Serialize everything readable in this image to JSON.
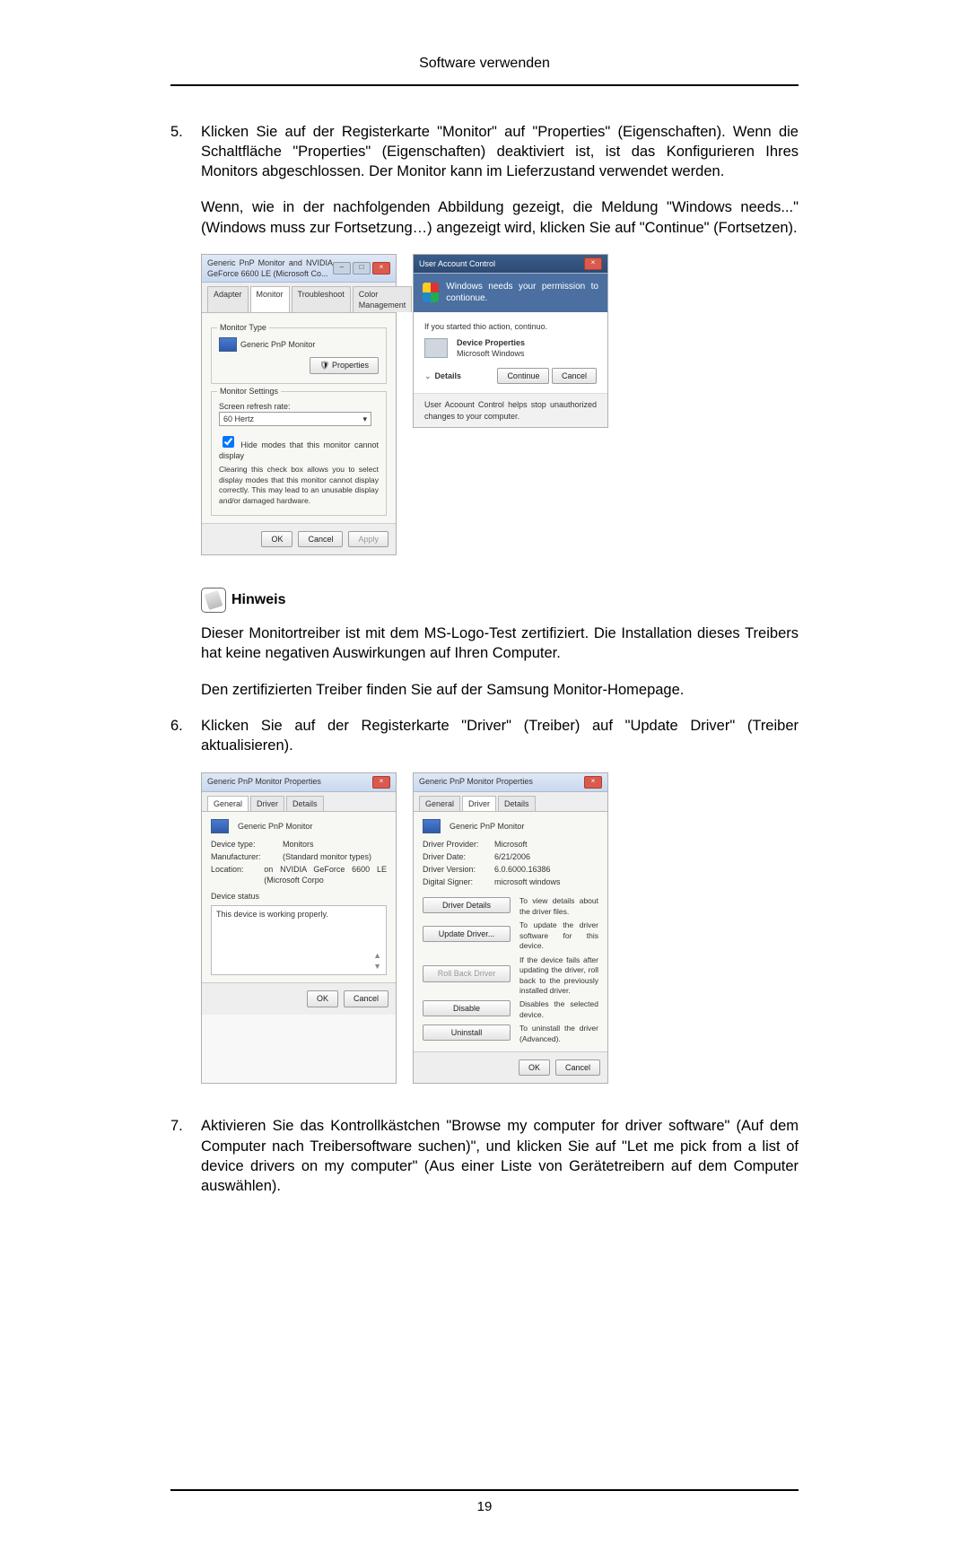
{
  "header": "Software verwenden",
  "item5": {
    "num": "5.",
    "p1": "Klicken Sie auf der Registerkarte \"Monitor\" auf \"Properties\" (Eigenschaften). Wenn die Schaltfläche \"Properties\" (Eigenschaften) deaktiviert ist, ist das Konfigurieren Ihres Monitors abgeschlossen. Der Monitor kann im Lieferzustand verwendet werden.",
    "p2": "Wenn, wie in der nachfolgenden Abbildung gezeigt, die Meldung \"Windows needs...\" (Windows muss zur Fortsetzung…) angezeigt wird, klicken Sie auf \"Continue\" (Fortsetzen)."
  },
  "screen1": {
    "title": "Generic PnP Monitor and NVIDIA GeForce 6600 LE (Microsoft Co...",
    "tabs": [
      "Adapter",
      "Monitor",
      "Troubleshoot",
      "Color Management"
    ],
    "active_tab": 1,
    "monitor_type_label": "Monitor Type",
    "monitor_type_value": "Generic PnP Monitor",
    "properties_btn": "Properties",
    "settings_label": "Monitor Settings",
    "refresh_label": "Screen refresh rate:",
    "refresh_value": "60 Hertz",
    "hide_modes": "Hide modes that this monitor cannot display",
    "hide_modes_desc": "Clearing this check box allows you to select display modes that this monitor cannot display correctly. This may lead to an unusable display and/or damaged hardware.",
    "ok": "OK",
    "cancel": "Cancel",
    "apply": "Apply"
  },
  "uac": {
    "title": "User Account Control",
    "headline": "Windows needs your permission to contionue.",
    "started": "If you started thio action, continuo.",
    "name": "Device Properties",
    "pub": "Microsoft Windows",
    "details": "Details",
    "continue": "Continue",
    "cancel": "Cancel",
    "footer": "User Acoount Control helps stop unauthorized changes to your computer."
  },
  "hinweis": {
    "label": "Hinweis",
    "p1": "Dieser Monitortreiber ist mit dem MS-Logo-Test zertifiziert. Die Installation dieses Treibers hat keine negativen Auswirkungen auf Ihren Computer.",
    "p2": "Den zertifizierten Treiber finden Sie auf der Samsung Monitor-Homepage."
  },
  "item6": {
    "num": "6.",
    "p1": "Klicken Sie auf der Registerkarte \"Driver\" (Treiber) auf \"Update Driver\" (Treiber aktualisieren)."
  },
  "props": {
    "title": "Generic PnP Monitor Properties",
    "tabs": [
      "General",
      "Driver",
      "Details"
    ],
    "name": "Generic PnP Monitor",
    "general": {
      "device_type_l": "Device type:",
      "device_type_v": "Monitors",
      "manufacturer_l": "Manufacturer:",
      "manufacturer_v": "(Standard monitor types)",
      "location_l": "Location:",
      "location_v": "on NVIDIA GeForce 6600 LE (Microsoft Corpo",
      "status_l": "Device status",
      "status_v": "This device is working properly.",
      "ok": "OK",
      "cancel": "Cancel"
    },
    "driver": {
      "provider_l": "Driver Provider:",
      "provider_v": "Microsoft",
      "date_l": "Driver Date:",
      "date_v": "6/21/2006",
      "version_l": "Driver Version:",
      "version_v": "6.0.6000.16386",
      "signer_l": "Digital Signer:",
      "signer_v": "microsoft windows",
      "btns": {
        "details": "Driver Details",
        "details_d": "To view details about the driver files.",
        "update": "Update Driver...",
        "update_d": "To update the driver software for this device.",
        "rollback": "Roll Back Driver",
        "rollback_d": "If the device fails after updating the driver, roll back to the previously installed driver.",
        "disable": "Disable",
        "disable_d": "Disables the selected device.",
        "uninstall": "Uninstall",
        "uninstall_d": "To uninstall the driver (Advanced)."
      },
      "ok": "OK",
      "cancel": "Cancel"
    }
  },
  "item7": {
    "num": "7.",
    "p1": "Aktivieren Sie das Kontrollkästchen \"Browse my computer for driver software\" (Auf dem Computer nach Treibersoftware suchen)\", und klicken Sie auf \"Let me pick from a list of device drivers on my computer\" (Aus einer Liste von Gerätetreibern auf dem Computer auswählen)."
  },
  "page_number": "19"
}
